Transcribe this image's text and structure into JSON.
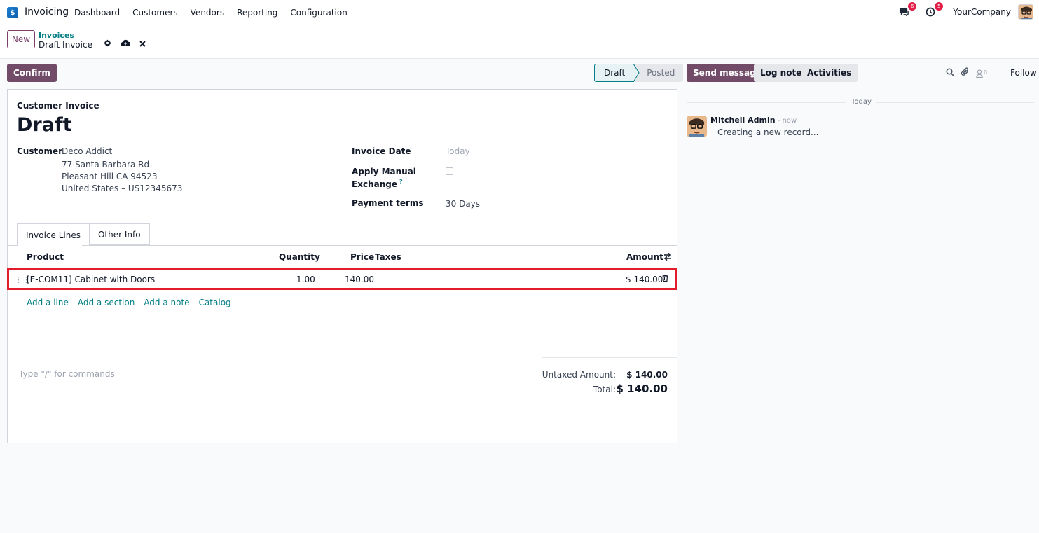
{
  "navbar": {
    "app_name": "Invoicing",
    "menu": [
      "Dashboard",
      "Customers",
      "Vendors",
      "Reporting",
      "Configuration"
    ],
    "messages_badge": "6",
    "activities_badge": "5",
    "company": "YourCompany"
  },
  "control_panel": {
    "new_label": "New",
    "breadcrumb_parent": "Invoices",
    "breadcrumb_current": "Draft Invoice"
  },
  "actions": {
    "confirm_label": "Confirm",
    "status_steps": [
      "Draft",
      "Posted"
    ],
    "current_status": "Draft"
  },
  "form": {
    "doc_type": "Customer Invoice",
    "title": "Draft",
    "customer_label": "Customer",
    "customer_name": "Deco Addict",
    "address_line1": "77 Santa Barbara Rd",
    "address_line2": "Pleasant Hill CA 94523",
    "address_line3": "United States – US12345673",
    "invoice_date_label": "Invoice Date",
    "invoice_date_placeholder": "Today",
    "apply_exchange_label_1": "Apply Manual",
    "apply_exchange_label_2": "Exchange",
    "help_marker": "?",
    "payment_terms_label": "Payment terms",
    "payment_terms_value": "30 Days",
    "tabs": [
      "Invoice Lines",
      "Other Info"
    ],
    "columns": {
      "product": "Product",
      "quantity": "Quantity",
      "price": "Price",
      "taxes": "Taxes",
      "amount": "Amount"
    },
    "lines": [
      {
        "product": "[E-COM11] Cabinet with Doors",
        "quantity": "1.00",
        "price": "140.00",
        "taxes": "",
        "amount": "$ 140.00"
      }
    ],
    "add_links": [
      "Add a line",
      "Add a section",
      "Add a note",
      "Catalog"
    ],
    "narration_placeholder": "Type \"/\" for commands",
    "untaxed_label": "Untaxed Amount:",
    "untaxed_value": "$ 140.00",
    "total_label": "Total:",
    "total_value": "$ 140.00"
  },
  "chatter": {
    "send_message": "Send message",
    "log_note": "Log note",
    "activities": "Activities",
    "followers_count": "0",
    "follow": "Follow",
    "date_separator": "Today",
    "message": {
      "author": "Mitchell Admin",
      "time": " - now",
      "body": "Creating a new record..."
    }
  },
  "colors": {
    "primary": "#714b67",
    "link": "#017e84",
    "highlight_border": "#e11d2b",
    "badge": "#e11d48"
  }
}
